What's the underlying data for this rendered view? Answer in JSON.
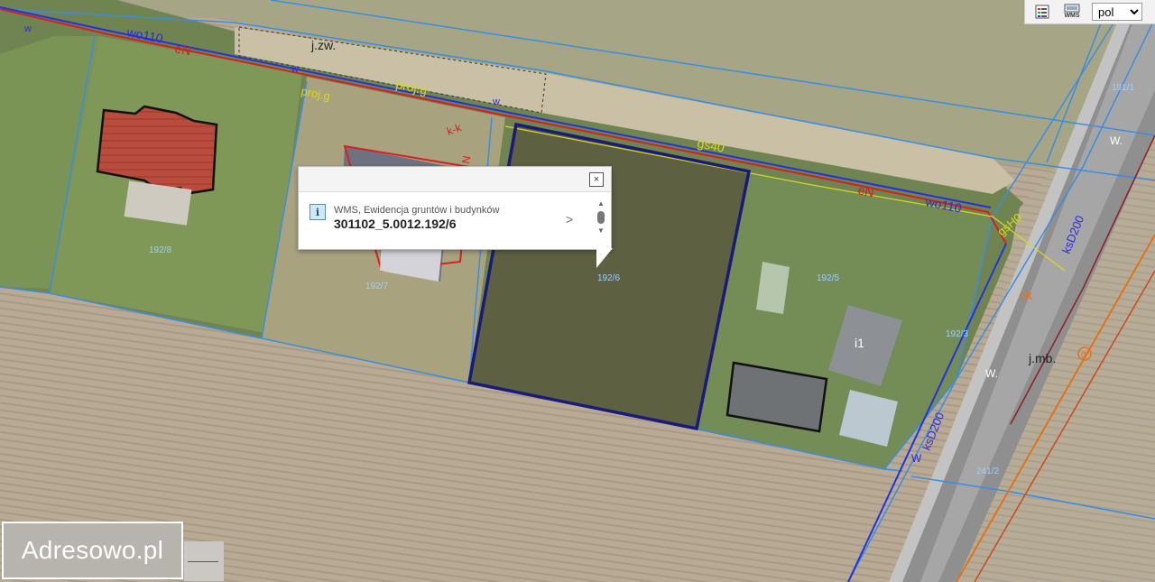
{
  "toolbar": {
    "legend_icon": "legend-list-icon",
    "wms_label": "WMS",
    "language_selected": "pol"
  },
  "popup": {
    "layer_name": "WMS, Ewidencja gruntów i budynków",
    "feature_id": "301102_5.0012.192/6",
    "info_glyph": "i",
    "close_glyph": "×",
    "next_glyph": ">"
  },
  "map_labels": {
    "road_wo110_a": "wo110",
    "road_eN_a": "eN",
    "road_wo110_b": "wo110",
    "road_eN_b": "eN",
    "j_zw": "j.zw.",
    "proj_g_a": "proj.g",
    "proj_g_b": "proj.g",
    "gs40": "gs40",
    "kk": "k-k",
    "red_N": "N",
    "parcel_192_8": "192/8",
    "parcel_192_7": "192/7",
    "parcel_192_6": "192/6",
    "parcel_192_5": "192/5",
    "parcel_192_3": "192/3",
    "parcel_191_1": "191/1",
    "parcel_241_2": "241/2",
    "i1": "i1",
    "j_mb": "j.mb.",
    "ksD200_a": "ksD200",
    "ksD200_b": "ksD200",
    "ck": "ck",
    "gsH0": "gsH0",
    "w_a": "w",
    "w_b": "w",
    "w_c": "w",
    "W_d": "W.",
    "W_e": "W.",
    "W_f": "W",
    "g_circle": "g"
  },
  "colors": {
    "parcel_line": "#3b8de0",
    "selected_parcel": "#1a1a7a",
    "utility_red": "#d42020",
    "utility_blue": "#2233dd",
    "utility_yellow": "#d8d820"
  },
  "branding": {
    "text": "Adresowo.pl"
  }
}
